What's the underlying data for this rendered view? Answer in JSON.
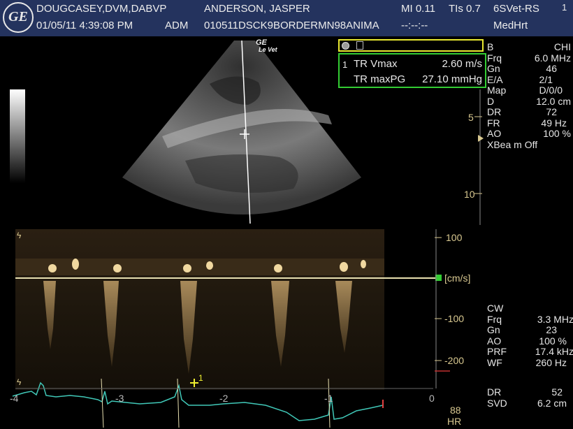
{
  "header": {
    "logo": "GE",
    "operator": "DOUGCASEY,DVM,DABVP",
    "datetime": "01/05/11 4:39:08 PM",
    "user": "ADM",
    "patient_name": "ANDERSON, JASPER",
    "patient_id": "010511DSCK9BORDERMN98ANIMA",
    "mi": "MI 0.11",
    "tis": "TIs 0.7",
    "probe": "6SVet-RS",
    "probe_suffix": "1",
    "time_blank": "--:--:--",
    "preset": "MedHrt"
  },
  "probe_mark": {
    "line1": "GE",
    "line2": "Le Vet"
  },
  "measurements": {
    "index": "1",
    "rows": [
      {
        "label": "TR Vmax",
        "value": "2.60 m/s"
      },
      {
        "label": "TR maxPG",
        "value": "27.10 mmHg"
      }
    ],
    "colors": {
      "border": "#33cc33",
      "cursor_box": "#e8e830"
    }
  },
  "bmode_params": [
    {
      "k": "B",
      "v": "CHI"
    },
    {
      "k": "Frq",
      "v": "6.0 MHz"
    },
    {
      "k": "Gn",
      "v": "46"
    },
    {
      "k": "E/A",
      "v": "2/1"
    },
    {
      "k": "Map",
      "v": "D/0/0"
    },
    {
      "k": "D",
      "v": "12.0 cm"
    },
    {
      "k": "DR",
      "v": "72"
    },
    {
      "k": "FR",
      "v": "49 Hz"
    },
    {
      "k": "AO",
      "v": "100 %"
    },
    {
      "k": "XBea m Off",
      "v": ""
    }
  ],
  "depth_marks": [
    "5",
    "10"
  ],
  "doppler_scale": {
    "ticks": [
      "100",
      "[cm/s]",
      "-100",
      "-200"
    ],
    "unit": "[cm/s]"
  },
  "cw_params": [
    {
      "k": "CW",
      "v": ""
    },
    {
      "k": "Frq",
      "v": "3.3 MHz"
    },
    {
      "k": "Gn",
      "v": "23"
    },
    {
      "k": "AO",
      "v": "100 %"
    },
    {
      "k": "PRF",
      "v": "17.4 kHz"
    },
    {
      "k": "WF",
      "v": "260 Hz"
    }
  ],
  "extra_params": [
    {
      "k": "DR",
      "v": "52"
    },
    {
      "k": "SVD",
      "v": "6.2 cm"
    }
  ],
  "time_axis": [
    "-4",
    "-3",
    "-2",
    "-1",
    "0"
  ],
  "hr": {
    "value": "88",
    "label": "HR"
  },
  "caliper_label": "1",
  "colors": {
    "header_bg": "#24335e",
    "ecg": "#40c8b8",
    "baseline": "#e8e0b0",
    "marker": "#d8c890"
  }
}
